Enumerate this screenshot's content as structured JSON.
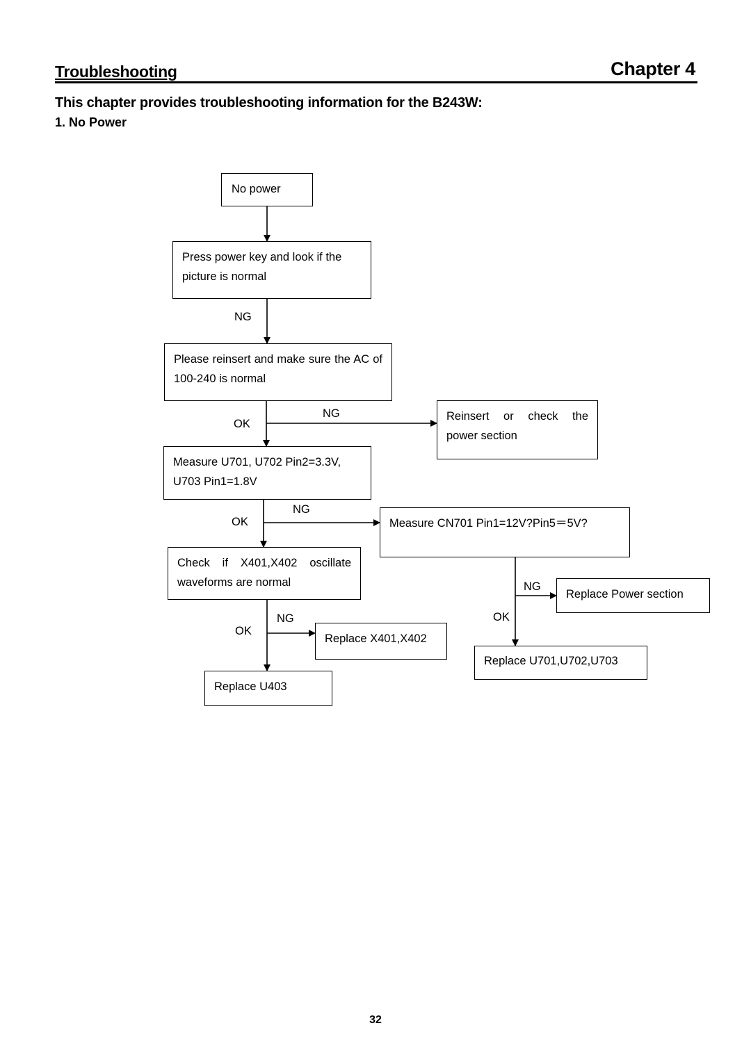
{
  "header": {
    "title": "Troubleshooting",
    "chapter": "Chapter 4"
  },
  "intro": "This chapter provides troubleshooting information for the B243W:",
  "section": "1. No Power",
  "flowchart": {
    "nodes": {
      "no_power": "No power",
      "press_power": "Press power key and look if the picture is normal",
      "reinsert_ac": "Please reinsert and make sure the AC of 100-240 is normal",
      "reinsert_check": "Reinsert or check the power section",
      "measure_u70x": "Measure U701, U702 Pin2=3.3V, U703 Pin1=1.8V",
      "measure_cn701": "Measure CN701 Pin1=12V?Pin5＝5V?",
      "check_x40x": "Check if X401,X402 oscillate waveforms are normal",
      "replace_power": "Replace Power section",
      "replace_x40x": "Replace X401,X402",
      "replace_u70x": "Replace U701,U702,U703",
      "replace_u403": "Replace U403"
    },
    "labels": {
      "ng": "NG",
      "ok": "OK"
    }
  },
  "footer": {
    "page_number": "32"
  }
}
